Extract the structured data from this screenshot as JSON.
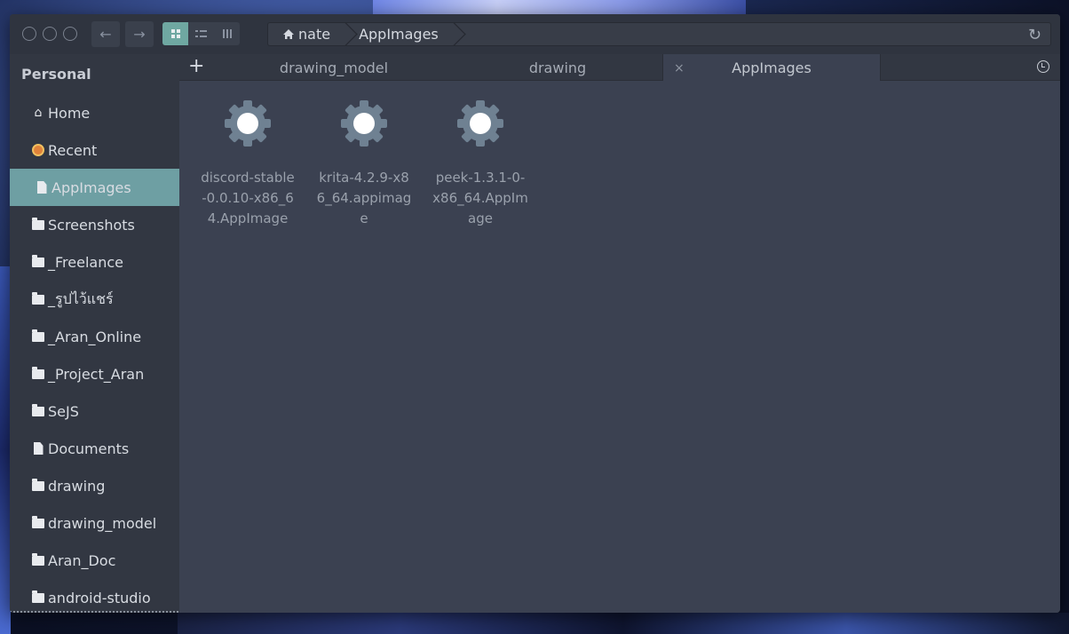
{
  "colors": {
    "window_bg": "#3b4151",
    "sidebar_bg": "#323742",
    "header_bg": "#2f343f",
    "accent": "#6e9fa3",
    "text": "#d8dce2",
    "muted_text": "#9aa1ac"
  },
  "header": {
    "window_controls": [
      "close-icon",
      "minimize-icon",
      "maximize-icon"
    ],
    "back_icon": "←",
    "forward_icon": "→",
    "view_modes": [
      "grid-view-icon",
      "list-view-icon",
      "column-view-icon"
    ],
    "breadcrumb": [
      {
        "label": "nate",
        "icon": "home-icon"
      },
      {
        "label": "AppImages"
      }
    ],
    "refresh_icon": "↻"
  },
  "sidebar": {
    "heading": "Personal",
    "items": [
      {
        "label": "Home",
        "icon": "home-icon"
      },
      {
        "label": "Recent",
        "icon": "recent-icon"
      },
      {
        "label": "AppImages",
        "icon": "file-icon",
        "selected": true
      },
      {
        "label": "Screenshots",
        "icon": "folder-icon"
      },
      {
        "label": "_Freelance",
        "icon": "folder-icon"
      },
      {
        "label": "_รูปไว้แชร์",
        "icon": "folder-icon"
      },
      {
        "label": "_Aran_Online",
        "icon": "folder-icon"
      },
      {
        "label": "_Project_Aran",
        "icon": "folder-icon"
      },
      {
        "label": "SeJS",
        "icon": "folder-icon"
      },
      {
        "label": "Documents",
        "icon": "file-icon"
      },
      {
        "label": "drawing",
        "icon": "folder-icon"
      },
      {
        "label": "drawing_model",
        "icon": "folder-icon"
      },
      {
        "label": "Aran_Doc",
        "icon": "folder-icon"
      },
      {
        "label": "android-studio",
        "icon": "folder-icon"
      }
    ]
  },
  "tabs": {
    "add_icon": "+",
    "items": [
      {
        "label": "drawing_model"
      },
      {
        "label": "drawing"
      },
      {
        "label": "AppImages",
        "active": true
      }
    ],
    "close_icon": "×"
  },
  "files": [
    {
      "name": "discord-stable-0.0.10-x86_64.AppImage",
      "icon": "gear-icon"
    },
    {
      "name": "krita-4.2.9-x86_64.appimage",
      "icon": "gear-icon"
    },
    {
      "name": "peek-1.3.1-0-x86_64.AppImage",
      "icon": "gear-icon"
    }
  ]
}
